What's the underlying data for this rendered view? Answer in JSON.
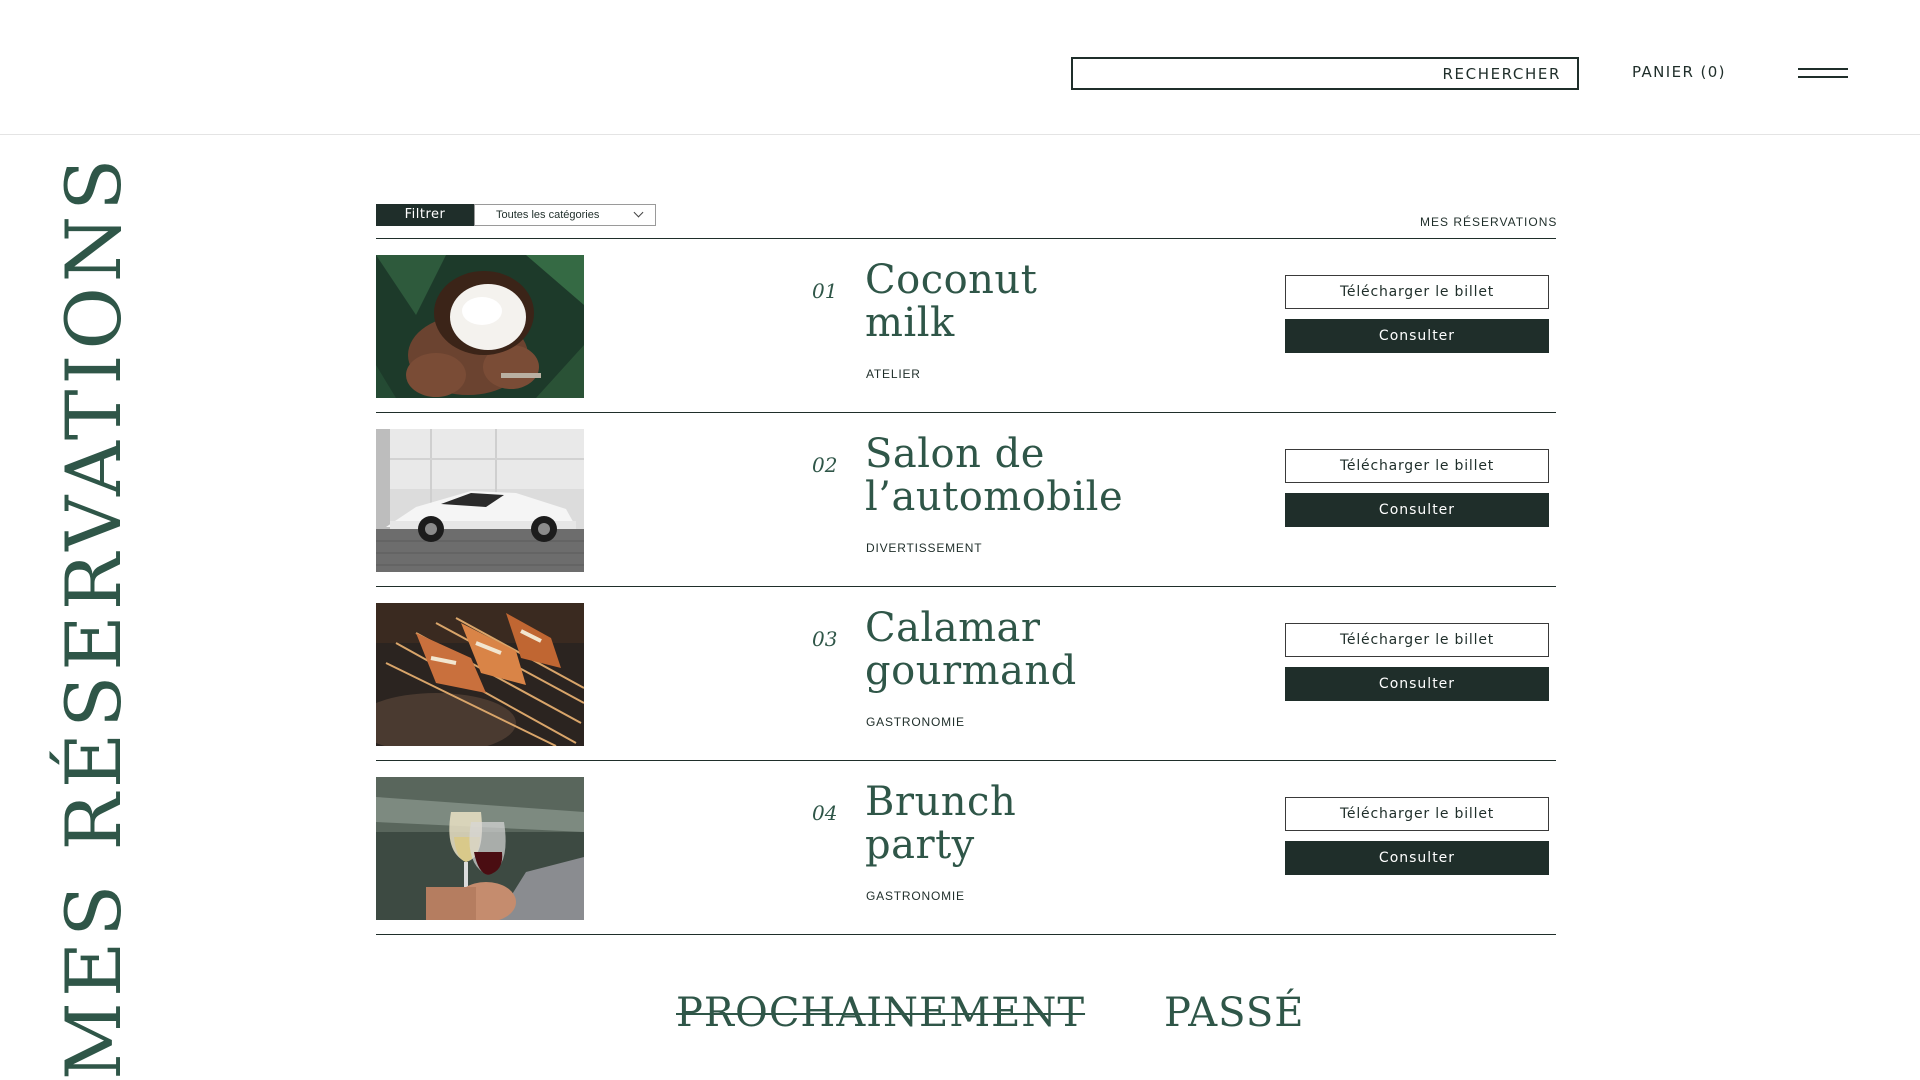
{
  "header": {
    "search_label": "RECHERCHER",
    "search_placeholder": "",
    "cart_label": "PANIER (0)",
    "menu_icon": "hamburger-icon"
  },
  "side_title": "MES RÉSERVATIONS",
  "toolbar": {
    "filter_label": "Filtrer",
    "category_selected": "Toutes les catégories",
    "my_bookings": "MES RÉSERVATIONS"
  },
  "bookings": [
    {
      "number": "01",
      "title_line1": "Coconut",
      "title_line2": "milk",
      "category": "ATELIER",
      "download_label": "Télécharger le billet",
      "view_label": "Consulter",
      "image": "coconut-photo"
    },
    {
      "number": "02",
      "title_line1": "Salon de",
      "title_line2": "l’automobile",
      "category": "DIVERTISSEMENT",
      "download_label": "Télécharger le billet",
      "view_label": "Consulter",
      "image": "sports-car-photo"
    },
    {
      "number": "03",
      "title_line1": "Calamar",
      "title_line2": "gourmand",
      "category": "GASTRONOMIE",
      "download_label": "Télécharger le billet",
      "view_label": "Consulter",
      "image": "grilled-squid-photo"
    },
    {
      "number": "04",
      "title_line1": "Brunch",
      "title_line2": "party",
      "category": "GASTRONOMIE",
      "download_label": "Télécharger le billet",
      "view_label": "Consulter",
      "image": "wine-glasses-photo"
    }
  ],
  "tabs": {
    "upcoming": "PROCHAINEMENT",
    "past": "PASSÉ"
  },
  "colors": {
    "primary_dark": "#1f2e2a",
    "accent_green": "#2f5648"
  }
}
